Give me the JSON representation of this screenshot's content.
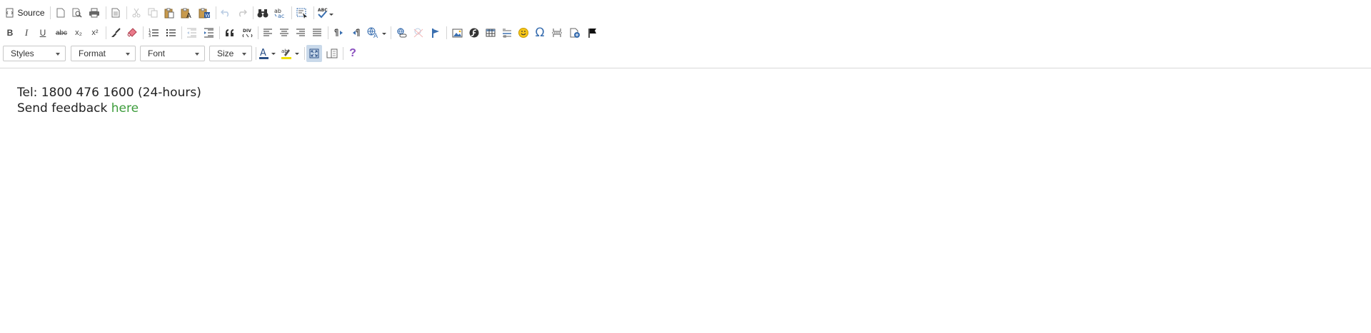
{
  "toolbar": {
    "source_label": "Source",
    "bold_label": "B",
    "italic_label": "I",
    "underline_label": "U",
    "strike_label": "abc",
    "subscript_label": "x₂",
    "superscript_label": "x²",
    "styles_label": "Styles",
    "format_label": "Format",
    "font_label": "Font",
    "size_label": "Size",
    "special_char_label": "Ω",
    "help_label": "?",
    "spell_label": "ABC"
  },
  "content": {
    "line1": "Tel: 1800 476 1600 (24-hours)",
    "line2_prefix": "Send feedback ",
    "link_text": "here"
  },
  "colors": {
    "link": "#3c9c3b",
    "active_button": "#c9d9ea",
    "help": "#8a4fbf"
  }
}
